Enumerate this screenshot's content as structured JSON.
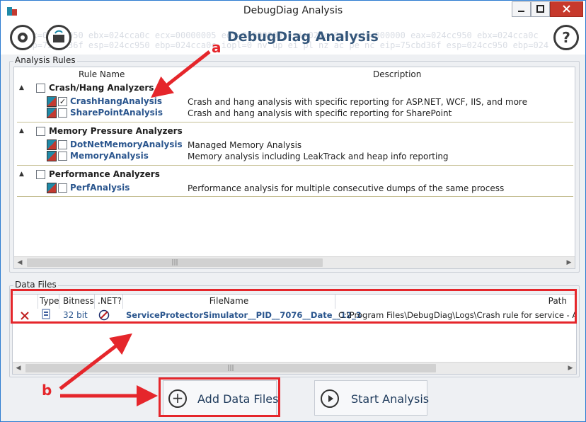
{
  "window": {
    "title": "DebugDiag Analysis"
  },
  "header": {
    "title": "DebugDiag Analysis",
    "hex_lines": [
      "eax=024cc950 ebx=024cca0c ecx=00000005 edx=00000000 esi=024cc9e8 edi=000000 eax=024cc950 ebx=024cca0c",
      "eip=75cbd36f esp=024cc950 ebp=024cca0c iopl=0 nv up ei pl nz ac pe nc eip=75cbd36f esp=024cc950 ebp=024"
    ]
  },
  "analysis_rules": {
    "label": "Analysis Rules",
    "col_rule_name": "Rule Name",
    "col_description": "Description",
    "categories": [
      {
        "name": "Crash/Hang Analyzers",
        "rules": [
          {
            "name": "CrashHangAnalysis",
            "checked": true,
            "description": "Crash and hang analysis with specific reporting for ASP.NET, WCF, IIS, and more"
          },
          {
            "name": "SharePointAnalysis",
            "checked": false,
            "description": "Crash and hang analysis with specific reporting for SharePoint"
          }
        ]
      },
      {
        "name": "Memory Pressure Analyzers",
        "rules": [
          {
            "name": "DotNetMemoryAnalysis",
            "checked": false,
            "description": "Managed Memory Analysis"
          },
          {
            "name": "MemoryAnalysis",
            "checked": false,
            "description": "Memory analysis including LeakTrack and heap info reporting"
          }
        ]
      },
      {
        "name": "Performance Analyzers",
        "rules": [
          {
            "name": "PerfAnalysis",
            "checked": false,
            "description": "Performance analysis for multiple consecutive dumps of the same process"
          }
        ]
      }
    ]
  },
  "data_files": {
    "label": "Data Files",
    "columns": {
      "type": "Type",
      "bitness": "Bitness",
      "dotnet": ".NET?",
      "filename": "FileName",
      "path": "Path"
    },
    "rows": [
      {
        "bitness": "32 bit",
        "filename": "ServiceProtectorSimulator__PID__7076__Date__12_3",
        "path": "C:\\Program Files\\DebugDiag\\Logs\\Crash rule for service - AA M"
      }
    ]
  },
  "buttons": {
    "add_data_files": "Add Data Files",
    "start_analysis": "Start Analysis"
  },
  "annotations": {
    "a": "a",
    "b": "b"
  },
  "colors": {
    "accent_red": "#e5262b",
    "title_blue": "#34567a",
    "rule_blue": "#2b568e"
  },
  "icons": [
    "app-icon",
    "settings-gear-icon",
    "open-folder-icon",
    "help-icon",
    "rule-icon",
    "delete-x-icon",
    "dump-file-icon",
    "dotnet-icon",
    "plus-circle-icon",
    "play-circle-icon"
  ]
}
